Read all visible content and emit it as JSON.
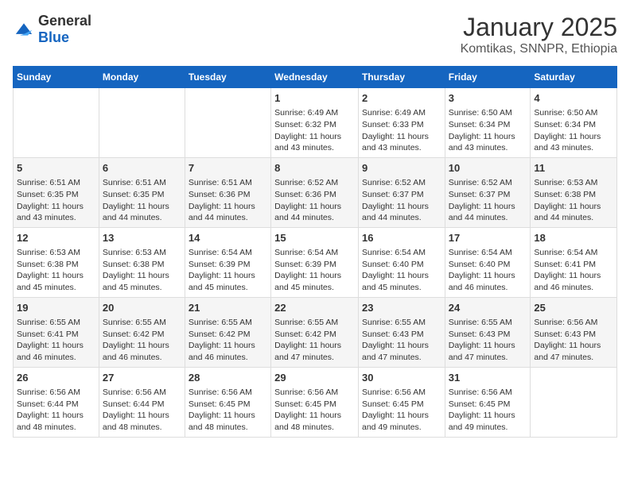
{
  "logo": {
    "general": "General",
    "blue": "Blue"
  },
  "title": "January 2025",
  "subtitle": "Komtikas, SNNPR, Ethiopia",
  "days_of_week": [
    "Sunday",
    "Monday",
    "Tuesday",
    "Wednesday",
    "Thursday",
    "Friday",
    "Saturday"
  ],
  "weeks": [
    [
      {
        "day": "",
        "info": ""
      },
      {
        "day": "",
        "info": ""
      },
      {
        "day": "",
        "info": ""
      },
      {
        "day": "1",
        "info": "Sunrise: 6:49 AM\nSunset: 6:32 PM\nDaylight: 11 hours and 43 minutes."
      },
      {
        "day": "2",
        "info": "Sunrise: 6:49 AM\nSunset: 6:33 PM\nDaylight: 11 hours and 43 minutes."
      },
      {
        "day": "3",
        "info": "Sunrise: 6:50 AM\nSunset: 6:34 PM\nDaylight: 11 hours and 43 minutes."
      },
      {
        "day": "4",
        "info": "Sunrise: 6:50 AM\nSunset: 6:34 PM\nDaylight: 11 hours and 43 minutes."
      }
    ],
    [
      {
        "day": "5",
        "info": "Sunrise: 6:51 AM\nSunset: 6:35 PM\nDaylight: 11 hours and 43 minutes."
      },
      {
        "day": "6",
        "info": "Sunrise: 6:51 AM\nSunset: 6:35 PM\nDaylight: 11 hours and 44 minutes."
      },
      {
        "day": "7",
        "info": "Sunrise: 6:51 AM\nSunset: 6:36 PM\nDaylight: 11 hours and 44 minutes."
      },
      {
        "day": "8",
        "info": "Sunrise: 6:52 AM\nSunset: 6:36 PM\nDaylight: 11 hours and 44 minutes."
      },
      {
        "day": "9",
        "info": "Sunrise: 6:52 AM\nSunset: 6:37 PM\nDaylight: 11 hours and 44 minutes."
      },
      {
        "day": "10",
        "info": "Sunrise: 6:52 AM\nSunset: 6:37 PM\nDaylight: 11 hours and 44 minutes."
      },
      {
        "day": "11",
        "info": "Sunrise: 6:53 AM\nSunset: 6:38 PM\nDaylight: 11 hours and 44 minutes."
      }
    ],
    [
      {
        "day": "12",
        "info": "Sunrise: 6:53 AM\nSunset: 6:38 PM\nDaylight: 11 hours and 45 minutes."
      },
      {
        "day": "13",
        "info": "Sunrise: 6:53 AM\nSunset: 6:38 PM\nDaylight: 11 hours and 45 minutes."
      },
      {
        "day": "14",
        "info": "Sunrise: 6:54 AM\nSunset: 6:39 PM\nDaylight: 11 hours and 45 minutes."
      },
      {
        "day": "15",
        "info": "Sunrise: 6:54 AM\nSunset: 6:39 PM\nDaylight: 11 hours and 45 minutes."
      },
      {
        "day": "16",
        "info": "Sunrise: 6:54 AM\nSunset: 6:40 PM\nDaylight: 11 hours and 45 minutes."
      },
      {
        "day": "17",
        "info": "Sunrise: 6:54 AM\nSunset: 6:40 PM\nDaylight: 11 hours and 46 minutes."
      },
      {
        "day": "18",
        "info": "Sunrise: 6:54 AM\nSunset: 6:41 PM\nDaylight: 11 hours and 46 minutes."
      }
    ],
    [
      {
        "day": "19",
        "info": "Sunrise: 6:55 AM\nSunset: 6:41 PM\nDaylight: 11 hours and 46 minutes."
      },
      {
        "day": "20",
        "info": "Sunrise: 6:55 AM\nSunset: 6:42 PM\nDaylight: 11 hours and 46 minutes."
      },
      {
        "day": "21",
        "info": "Sunrise: 6:55 AM\nSunset: 6:42 PM\nDaylight: 11 hours and 46 minutes."
      },
      {
        "day": "22",
        "info": "Sunrise: 6:55 AM\nSunset: 6:42 PM\nDaylight: 11 hours and 47 minutes."
      },
      {
        "day": "23",
        "info": "Sunrise: 6:55 AM\nSunset: 6:43 PM\nDaylight: 11 hours and 47 minutes."
      },
      {
        "day": "24",
        "info": "Sunrise: 6:55 AM\nSunset: 6:43 PM\nDaylight: 11 hours and 47 minutes."
      },
      {
        "day": "25",
        "info": "Sunrise: 6:56 AM\nSunset: 6:43 PM\nDaylight: 11 hours and 47 minutes."
      }
    ],
    [
      {
        "day": "26",
        "info": "Sunrise: 6:56 AM\nSunset: 6:44 PM\nDaylight: 11 hours and 48 minutes."
      },
      {
        "day": "27",
        "info": "Sunrise: 6:56 AM\nSunset: 6:44 PM\nDaylight: 11 hours and 48 minutes."
      },
      {
        "day": "28",
        "info": "Sunrise: 6:56 AM\nSunset: 6:45 PM\nDaylight: 11 hours and 48 minutes."
      },
      {
        "day": "29",
        "info": "Sunrise: 6:56 AM\nSunset: 6:45 PM\nDaylight: 11 hours and 48 minutes."
      },
      {
        "day": "30",
        "info": "Sunrise: 6:56 AM\nSunset: 6:45 PM\nDaylight: 11 hours and 49 minutes."
      },
      {
        "day": "31",
        "info": "Sunrise: 6:56 AM\nSunset: 6:45 PM\nDaylight: 11 hours and 49 minutes."
      },
      {
        "day": "",
        "info": ""
      }
    ]
  ]
}
